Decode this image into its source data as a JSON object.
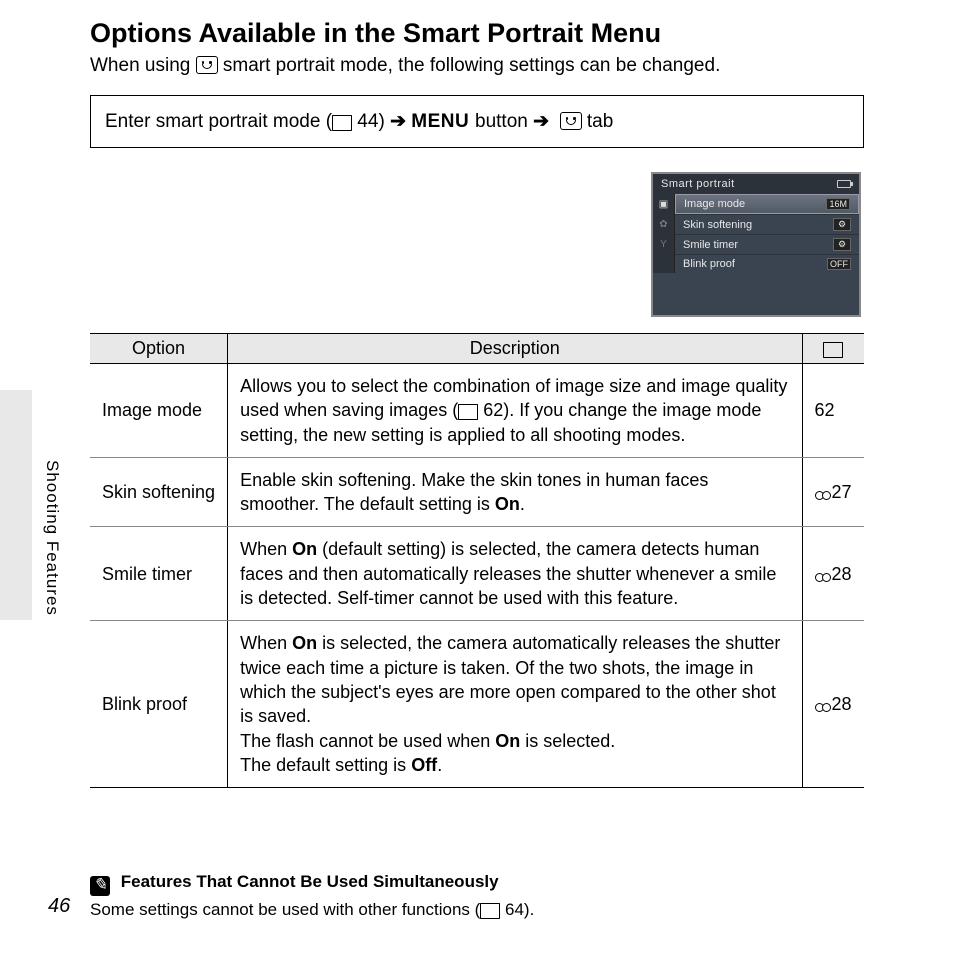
{
  "title": "Options Available in the Smart Portrait Menu",
  "intro_before": "When using ",
  "intro_after": " smart portrait mode, the following settings can be changed.",
  "nav": {
    "part1": "Enter smart portrait mode (",
    "pageref": " 44) ",
    "arrow1": "➔",
    "menu": " MENU ",
    "button": "button ",
    "arrow2": "➔",
    "tab": " tab"
  },
  "screenshot": {
    "title": "Smart portrait",
    "rows": [
      {
        "label": "Image mode",
        "value": "16M",
        "selected": true
      },
      {
        "label": "Skin softening",
        "value": "⚙",
        "selected": false
      },
      {
        "label": "Smile timer",
        "value": "⚙",
        "selected": false
      },
      {
        "label": "Blink proof",
        "value": "OFF",
        "selected": false
      }
    ]
  },
  "side_label": "Shooting Features",
  "table": {
    "headers": {
      "option": "Option",
      "desc": "Description",
      "ref": "book"
    },
    "rows": [
      {
        "option": "Image mode",
        "desc_html": "Allows you to select the combination of image size and image quality used when saving images (<span class='book-icon'></span> 62). If you change the image mode setting, the new setting is applied to all shooting modes.",
        "ref_html": "62"
      },
      {
        "option": "Skin softening",
        "desc_html": "Enable skin softening. Make the skin tones in human faces smoother. The default setting is <b>On</b>.",
        "ref_html": "<span class='ref-icon'></span>27"
      },
      {
        "option": "Smile timer",
        "desc_html": "When <b>On</b> (default setting) is selected, the camera detects human faces and then automatically releases the shutter whenever a smile is detected. Self-timer cannot be used with this feature.",
        "ref_html": "<span class='ref-icon'></span>28"
      },
      {
        "option": "Blink proof",
        "desc_html": "When <b>On</b> is selected, the camera automatically releases the shutter twice each time a picture is taken. Of the two shots, the image in which the subject's eyes are more open compared to the other shot is saved.<br>The flash cannot be used when <b>On</b> is selected.<br>The default setting is <b>Off</b>.",
        "ref_html": "<span class='ref-icon'></span>28"
      }
    ]
  },
  "note": {
    "title": "Features That Cannot Be Used Simultaneously",
    "body_before": "Some settings cannot be used with other functions (",
    "body_ref": " 64)."
  },
  "page_number": "46",
  "chart_data": {
    "type": "table",
    "title": "Options Available in the Smart Portrait Menu",
    "columns": [
      "Option",
      "Description",
      "Reference"
    ],
    "rows": [
      [
        "Image mode",
        "Allows you to select the combination of image size and image quality used when saving images (p.62). If you change the image mode setting, the new setting is applied to all shooting modes.",
        "62"
      ],
      [
        "Skin softening",
        "Enable skin softening. Make the skin tones in human faces smoother. The default setting is On.",
        "E27"
      ],
      [
        "Smile timer",
        "When On (default setting) is selected, the camera detects human faces and then automatically releases the shutter whenever a smile is detected. Self-timer cannot be used with this feature.",
        "E28"
      ],
      [
        "Blink proof",
        "When On is selected, the camera automatically releases the shutter twice each time a picture is taken. Of the two shots, the image in which the subject's eyes are more open compared to the other shot is saved. The flash cannot be used when On is selected. The default setting is Off.",
        "E28"
      ]
    ]
  }
}
